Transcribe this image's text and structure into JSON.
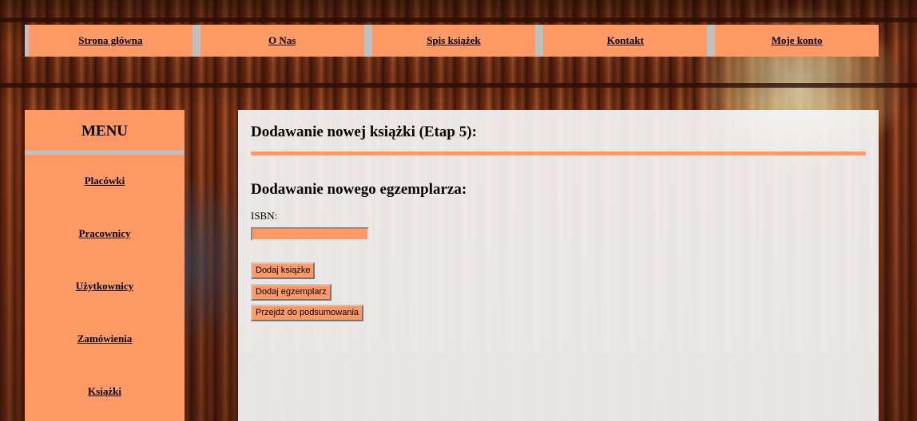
{
  "nav": {
    "items": [
      {
        "label": "Strona główna"
      },
      {
        "label": "O Nas"
      },
      {
        "label": "Spis książek"
      },
      {
        "label": "Kontakt"
      },
      {
        "label": "Moje konto"
      }
    ]
  },
  "sidebar": {
    "title": "MENU",
    "items": [
      {
        "label": "Placówki"
      },
      {
        "label": "Pracownicy"
      },
      {
        "label": "Użytkownicy"
      },
      {
        "label": "Zamówienia"
      },
      {
        "label": "Książki"
      }
    ]
  },
  "main": {
    "title": "Dodawanie nowej książki (Etap 5):",
    "subtitle": "Dodawanie nowego egzemplarza:",
    "isbn_label": "ISBN:",
    "isbn_value": "",
    "buttons": {
      "add_book": "Dodaj książke",
      "add_copy": "Dodaj egzemplarz",
      "summary": "Przejdź do podsumowania"
    }
  },
  "colors": {
    "accent": "#ff9966",
    "separator": "#c0c0c0",
    "panel": "#f5f5f5"
  }
}
